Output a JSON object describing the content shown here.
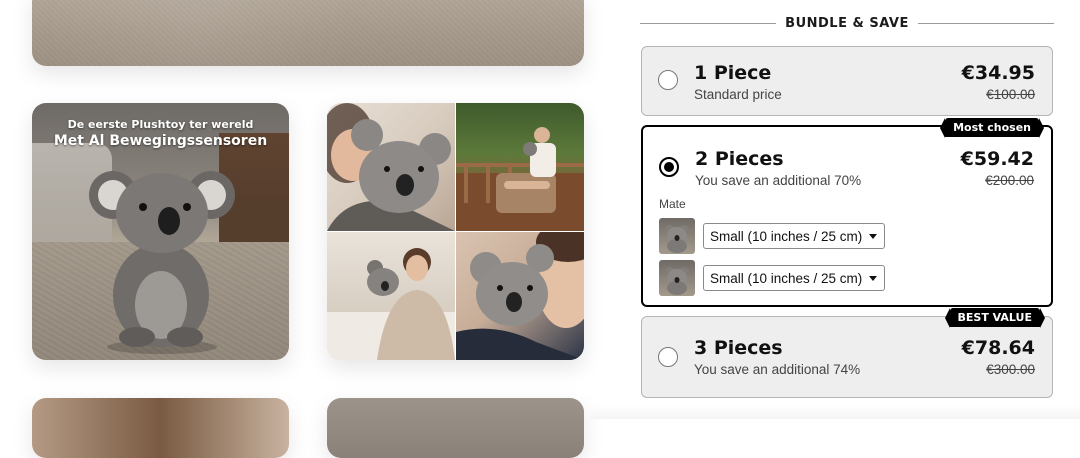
{
  "gallery": {
    "koala_image": {
      "headline_small": "De eerste Plushtoy ter wereld",
      "headline_large": "Met Al Bewegingssensoren"
    }
  },
  "bundle": {
    "heading": "BUNDLE & SAVE",
    "offers": [
      {
        "title": "1 Piece",
        "subtitle": "Standard price",
        "price": "€34.95",
        "old_price": "€100.00",
        "selected": false
      },
      {
        "title": "2 Pieces",
        "subtitle": "You save an additional 70%",
        "price": "€59.42",
        "old_price": "€200.00",
        "tag": "Most chosen",
        "selected": true,
        "variant_label": "Mate",
        "variants": [
          {
            "value": "Small (10 inches / 25 cm)"
          },
          {
            "value": "Small (10 inches / 25 cm)"
          }
        ]
      },
      {
        "title": "3 Pieces",
        "subtitle": "You save an additional 74%",
        "price": "€78.64",
        "old_price": "€300.00",
        "tag": "BEST VALUE",
        "selected": false
      }
    ]
  }
}
